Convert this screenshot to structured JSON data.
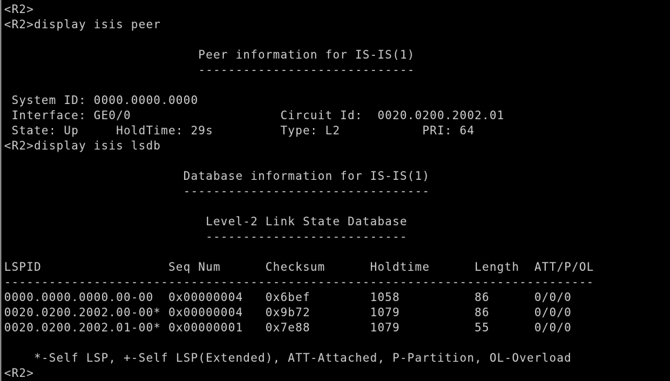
{
  "terminal": {
    "text_color": "#d0d0d0",
    "background_color": "#000000",
    "lines": [
      "<R2>",
      "<R2>display isis peer",
      "",
      "                          Peer information for IS-IS(1)",
      "                          -----------------------------",
      "",
      " System ID: 0000.0000.0000",
      " Interface: GE0/0                    Circuit Id:  0020.0200.2002.01",
      " State: Up     HoldTime: 29s         Type: L2           PRI: 64",
      "<R2>display isis lsdb",
      "",
      "                        Database information for IS-IS(1)",
      "                        ---------------------------------",
      "",
      "                           Level-2 Link State Database",
      "                           ---------------------------",
      "",
      "LSPID                 Seq Num      Checksum      Holdtime      Length  ATT/P/OL",
      "-------------------------------------------------------------------------------",
      "0000.0000.0000.00-00  0x00000004   0x6bef        1058          86      0/0/0",
      "0020.0200.2002.00-00* 0x00000004   0x9b72        1079          86      0/0/0",
      "0020.0200.2002.01-00* 0x00000001   0x7e88        1079          55      0/0/0",
      "",
      "    *-Self LSP, +-Self LSP(Extended), ATT-Attached, P-Partition, OL-Overload",
      "<R2>"
    ]
  }
}
